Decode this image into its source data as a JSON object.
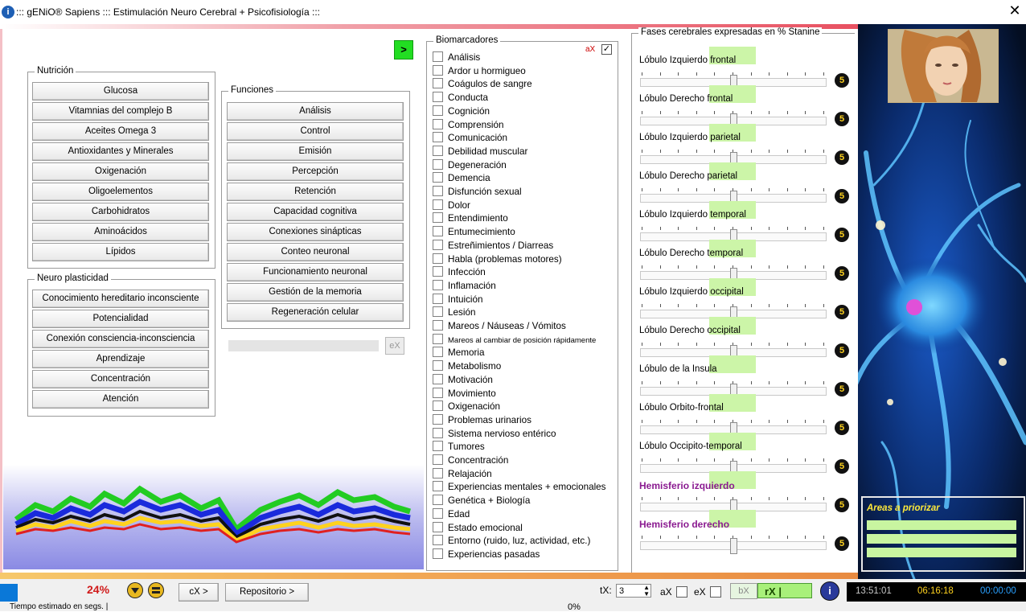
{
  "window": {
    "title": "::: gENiO® Sapiens ::: Estimulación Neuro Cerebral + Psicofisiología :::",
    "close_glyph": "✕",
    "info_glyph": "i"
  },
  "next_button": ">",
  "nutricion": {
    "legend": "Nutrición",
    "buttons": [
      "Glucosa",
      "Vitamnias del complejo B",
      "Aceites Omega 3",
      "Antioxidantes y Minerales",
      "Oxigenación",
      "Oligoelementos",
      "Carbohidratos",
      "Aminoácidos",
      "Lípidos"
    ]
  },
  "neuro": {
    "legend": "Neuro plasticidad",
    "buttons": [
      "Conocimiento hereditario inconsciente",
      "Potencialidad",
      "Conexión consciencia-inconsciencia",
      "Aprendizaje",
      "Concentración",
      "Atención"
    ]
  },
  "funciones": {
    "legend": "Funciones",
    "buttons": [
      "Análisis",
      "Control",
      "Emisión",
      "Percepción",
      "Retención",
      "Capacidad cognitiva",
      "Conexiones sinápticas",
      "Conteo neuronal",
      "Funcionamiento neuronal",
      "Gestión de la memoria",
      "Regeneración celular"
    ],
    "ex_label": "eX"
  },
  "biomarcadores": {
    "legend": "Biomarcadores",
    "ax_label": "aX",
    "ax_checked": "✓",
    "items": [
      "Análisis",
      "Ardor u hormigueo",
      "Coágulos de sangre",
      "Conducta",
      "Cognición",
      "Comprensión",
      "Comunicación",
      "Debilidad muscular",
      "Degeneración",
      "Demencia",
      "Disfunción sexual",
      "Dolor",
      "Entendimiento",
      "Entumecimiento",
      "Estreñimientos / Diarreas",
      "Habla (problemas motores)",
      "Infección",
      "Inflamación",
      "Intuición",
      "Lesión",
      "Mareos / Náuseas / Vómitos",
      "Mareos al cambiar de posición rápidamente",
      "Memoria",
      "Metabolismo",
      "Motivación",
      "Movimiento",
      "Oxigenación",
      "Problemas urinarios",
      "Sistema nervioso entérico",
      "Tumores",
      "Concentración",
      "Relajación",
      "Experiencias mentales + emocionales",
      "Genética + Biología",
      "Edad",
      "Estado emocional",
      "Entorno (ruido, luz, actividad, etc.)",
      "Experiencias pasadas"
    ]
  },
  "fases": {
    "legend": "Fases cerebrales expresadas en % Stanine",
    "lobes": [
      {
        "name": "Lóbulo Izquierdo frontal",
        "stanine": "5"
      },
      {
        "name": "Lóbulo Derecho frontal",
        "stanine": "5"
      },
      {
        "name": "Lóbulo Izquierdo parietal",
        "stanine": "5"
      },
      {
        "name": "Lóbulo Derecho parietal",
        "stanine": "5"
      },
      {
        "name": "Lóbulo Izquierdo temporal",
        "stanine": "5"
      },
      {
        "name": "Lóbulo Derecho temporal",
        "stanine": "5"
      },
      {
        "name": "Lóbulo Izquierdo occipital",
        "stanine": "5"
      },
      {
        "name": "Lóbulo Derecho occipital",
        "stanine": "5"
      },
      {
        "name": "Lóbulo de la Insula",
        "stanine": "5"
      },
      {
        "name": "Lóbulo Orbito-frontal",
        "stanine": "5"
      },
      {
        "name": "Lóbulo Occipito-temporal",
        "stanine": "5"
      },
      {
        "name": "Hemisferio izquierdo",
        "stanine": "5"
      },
      {
        "name": "Hemisferio derecho",
        "stanine": "5"
      }
    ]
  },
  "areas": {
    "title": "Areas a priorizar"
  },
  "bottom": {
    "percent": "24%",
    "cx_button": "cX >",
    "repo_button": "Repositorio >",
    "tx_label": "tX:",
    "tx_value": "3",
    "ax_label": "aX",
    "ex_label": "eX",
    "bx_label": "bX",
    "rx_label": "rX |",
    "status_text": "Tiempo estimado en segs. |",
    "progress_pct": "0%",
    "clock_1": "13:51:01",
    "clock_2": "06:16:18",
    "clock_3": "00:00:00",
    "colors": {
      "clock_1": "#c8c8c8",
      "clock_2": "#ffd21e",
      "clock_3": "#2aa0ff"
    }
  }
}
